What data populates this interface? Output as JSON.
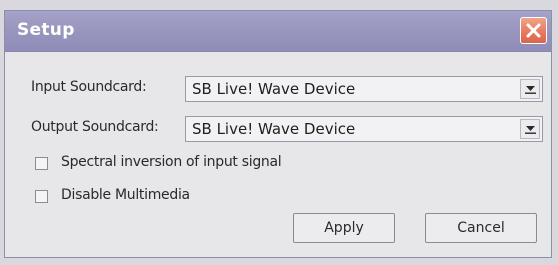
{
  "window": {
    "title": "Setup",
    "close_icon": "close-icon"
  },
  "input": {
    "label": "Input Soundcard:",
    "value": "SB Live! Wave Device"
  },
  "output": {
    "label": "Output Soundcard:",
    "value": "SB Live! Wave Device"
  },
  "options": {
    "spectral_label": "Spectral inversion of input signal",
    "spectral_checked": false,
    "multimedia_label": "Disable Multimedia",
    "multimedia_checked": false
  },
  "buttons": {
    "apply": "Apply",
    "cancel": "Cancel"
  },
  "colors": {
    "titlebar": "#9a97c0",
    "close_button": "#e6785c",
    "background": "#e7e6e8"
  }
}
